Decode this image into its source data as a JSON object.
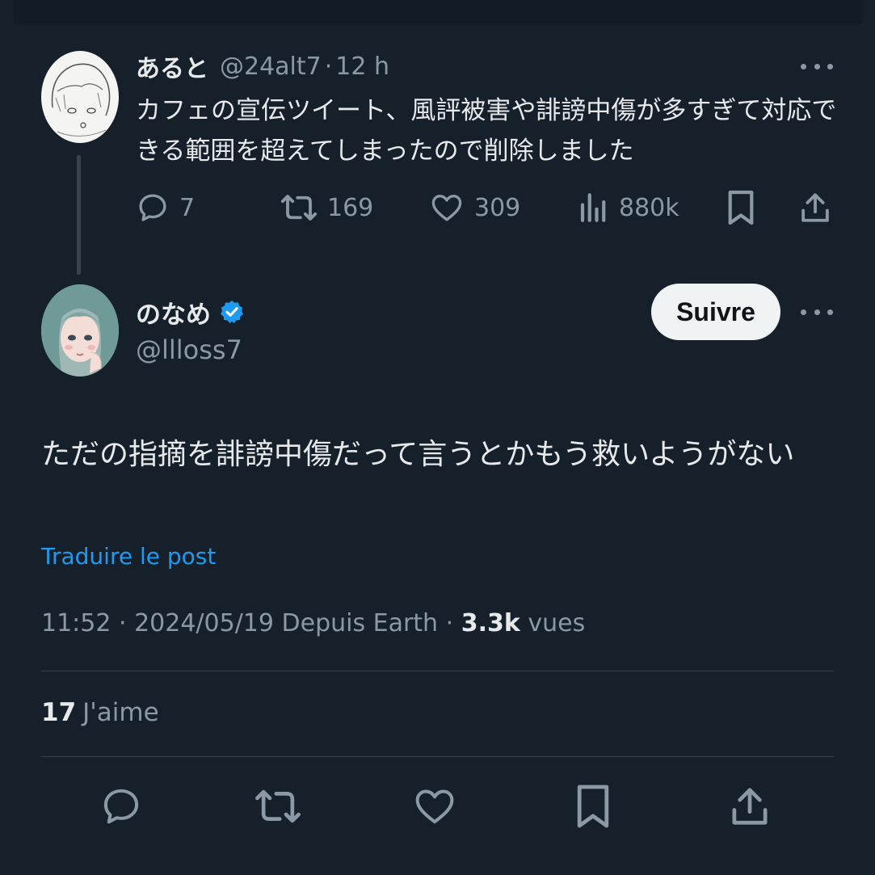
{
  "parent_tweet": {
    "display_name": "あると",
    "handle": "@24alt7",
    "separator": "·",
    "time": "12 h",
    "text": "カフェの宣伝ツイート、風評被害や誹謗中傷が多すぎて対応できる範囲を超えてしまったので削除しました",
    "actions": {
      "replies": "7",
      "reposts": "169",
      "likes": "309",
      "views": "880k"
    }
  },
  "main_tweet": {
    "display_name": "のなめ",
    "handle": "@llloss7",
    "follow_label": "Suivre",
    "text": "ただの指摘を誹謗中傷だって言うとかもう救いようがない",
    "translate_label": "Traduire le post",
    "timestamp": "11:52 · 2024/05/19 Depuis Earth ·",
    "views_count": "3.3k",
    "views_label": "vues",
    "likes_count": "17",
    "likes_label": "J'aime"
  },
  "colors": {
    "background": "#15202b",
    "accent": "#1d9bf0",
    "muted": "#8b98a5",
    "verified": "#1d9bf0"
  },
  "icons": [
    "reply-icon",
    "repost-icon",
    "like-icon",
    "views-icon",
    "bookmark-icon",
    "share-icon",
    "verified-badge-icon",
    "more-icon"
  ]
}
